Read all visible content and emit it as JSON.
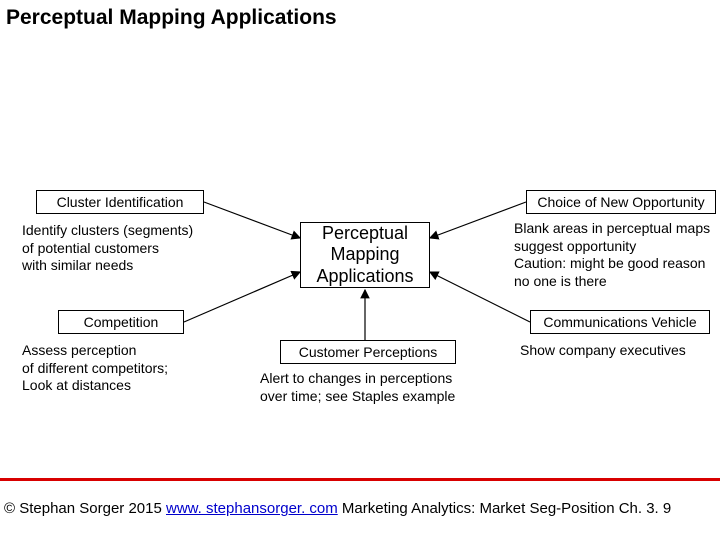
{
  "title": "Perceptual Mapping Applications",
  "center": {
    "label": "Perceptual\nMapping\nApplications"
  },
  "nodes": {
    "top_left": {
      "label": "Cluster Identification",
      "desc": "Identify clusters (segments)\nof potential customers\nwith similar needs"
    },
    "top_right": {
      "label": "Choice of New Opportunity",
      "desc": "Blank areas in perceptual maps\nsuggest opportunity\nCaution: might be good reason\nno one is there"
    },
    "bottom_left": {
      "label": "Competition",
      "desc": "Assess perception\nof different competitors;\nLook at distances"
    },
    "bottom_right": {
      "label": "Communications Vehicle",
      "desc": "Show company executives"
    },
    "bottom_center": {
      "label": "Customer Perceptions",
      "desc": "Alert to changes in perceptions\nover time; see Staples example"
    }
  },
  "footer": {
    "prefix": "© Stephan Sorger 2015 ",
    "link_text": "www. stephansorger. com",
    "link_href": "http://www.stephansorger.com",
    "suffix": " Marketing Analytics: Market Seg-Position Ch. 3. 9"
  }
}
